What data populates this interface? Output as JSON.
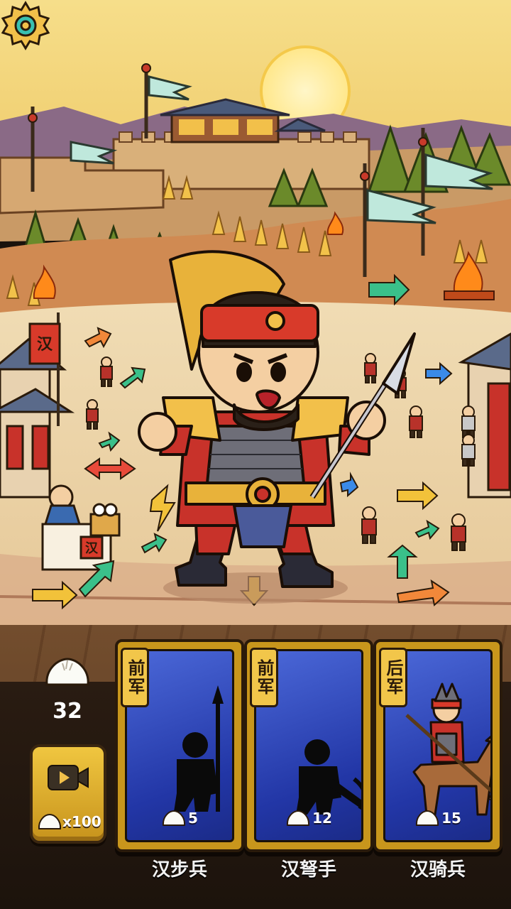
{
  "scene": {
    "banner_char": "汉",
    "box_seal_char": "汉"
  },
  "icons": {
    "settings": "gear-icon",
    "resource": "steamed-bun-icon",
    "video": "video-camera-icon"
  },
  "resources": {
    "buns": "32"
  },
  "video_reward": {
    "cost": "x100"
  },
  "units": [
    {
      "tag": "前军",
      "cost": "5",
      "name": "汉步兵",
      "art": "infantry-silhouette"
    },
    {
      "tag": "前军",
      "cost": "12",
      "name": "汉弩手",
      "art": "crossbowman-silhouette"
    },
    {
      "tag": "后军",
      "cost": "15",
      "name": "汉骑兵",
      "art": "cavalry-unit"
    }
  ],
  "colors": {
    "card_blue": "#2236a6",
    "card_gold": "#c8961c",
    "sky": "#f2d67a"
  }
}
